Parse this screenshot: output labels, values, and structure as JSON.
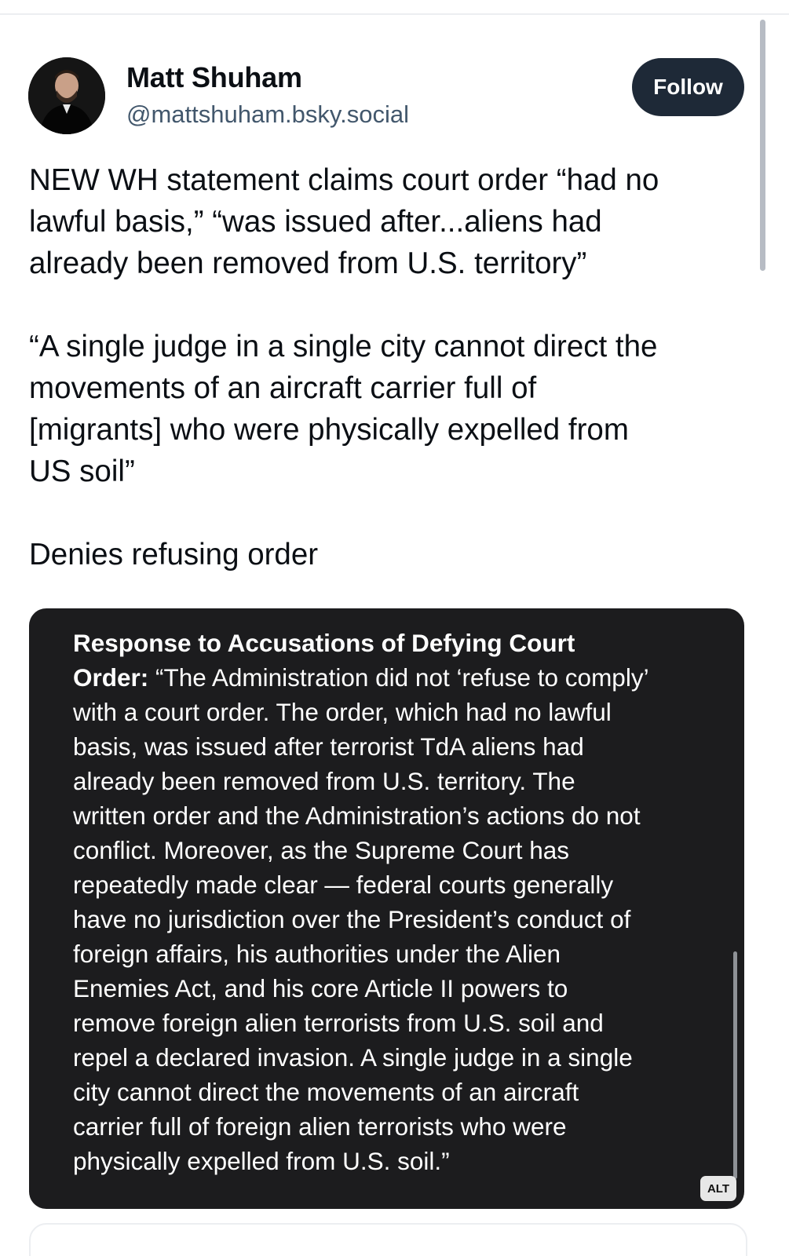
{
  "author": {
    "display_name": "Matt Shuham",
    "handle": "@mattshuham.bsky.social"
  },
  "actions": {
    "follow_label": "Follow"
  },
  "post": {
    "paragraphs": [
      [
        "NEW WH statement claims court order “had no",
        "lawful basis,” “was issued after...aliens had",
        "already been removed from U.S. territory”"
      ],
      [
        "“A single judge in a single city cannot direct the",
        "movements of an aircraft carrier full of",
        "[migrants] who were physically expelled from",
        "US soil”"
      ],
      [
        "Denies refusing order"
      ]
    ]
  },
  "embed": {
    "heading_bold": "Response to Accusations of Defying Court\nOrder:",
    "body": " “The Administration did not ‘refuse to comply’\nwith a court order. The order, which had no lawful\nbasis, was issued after terrorist TdA aliens had\nalready been removed from U.S. territory. The\nwritten order and the Administration’s actions do not\nconflict. Moreover, as the Supreme Court has\nrepeatedly made clear — federal courts generally\nhave no jurisdiction over the President’s conduct of\nforeign affairs, his authorities under the Alien\nEnemies Act, and his core Article II powers to\nremove foreign alien terrorists from U.S. soil and\nrepel a declared invasion. A single judge in a single\ncity cannot direct the movements of an aircraft\ncarrier full of foreign alien terrorists who were\nphysically expelled from U.S. soil.”",
    "alt_badge": "ALT"
  },
  "icons": {
    "avatar": "user-avatar-photo"
  }
}
